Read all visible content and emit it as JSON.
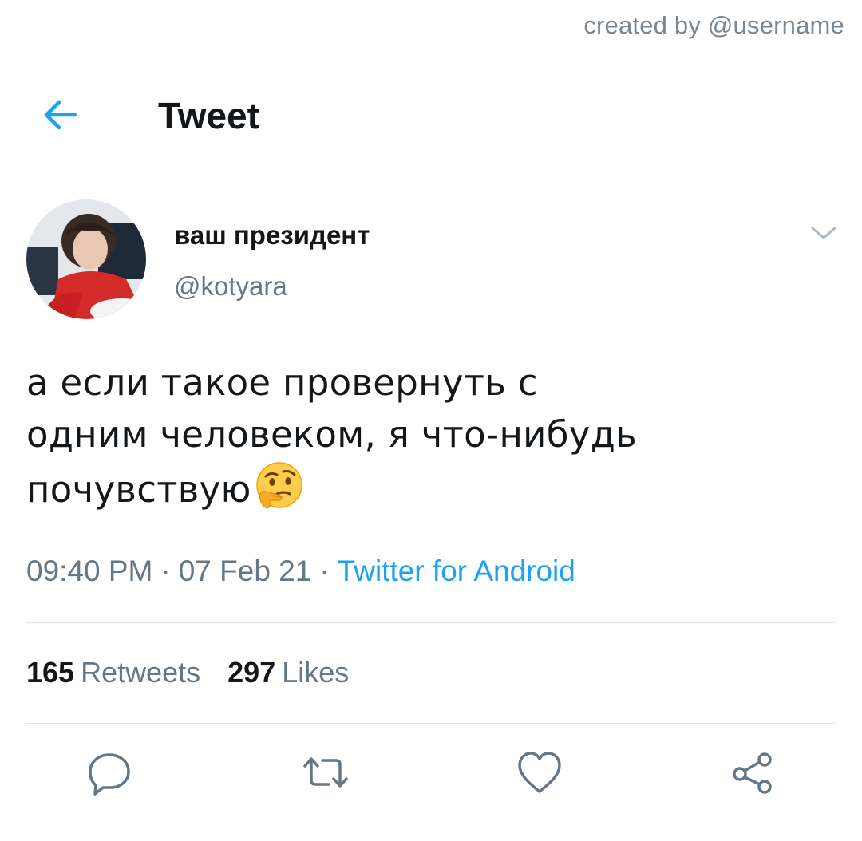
{
  "watermark": "created by @username",
  "header": {
    "title": "Tweet",
    "back_icon": "arrow-left-icon"
  },
  "author": {
    "display_name": "ваш президент",
    "handle": "@kotyara",
    "menu_icon": "chevron-down-icon"
  },
  "tweet": {
    "lines": [
      "а если такое провернуть с",
      "одним человеком, я что-нибудь",
      "почувствую"
    ],
    "emoji": "thinking-face-emoji"
  },
  "meta": {
    "time": "09:40 PM",
    "date": "07 Feb 21",
    "separator": "·",
    "source": "Twitter for Android"
  },
  "stats": {
    "retweets_count": "165",
    "retweets_label": "Retweets",
    "likes_count": "297",
    "likes_label": "Likes"
  },
  "actions": [
    "reply-icon",
    "retweet-icon",
    "like-icon",
    "share-icon"
  ],
  "colors": {
    "accent": "#1da1f2",
    "text": "#14171a",
    "muted": "#657786",
    "divider": "#e1e5e8"
  }
}
